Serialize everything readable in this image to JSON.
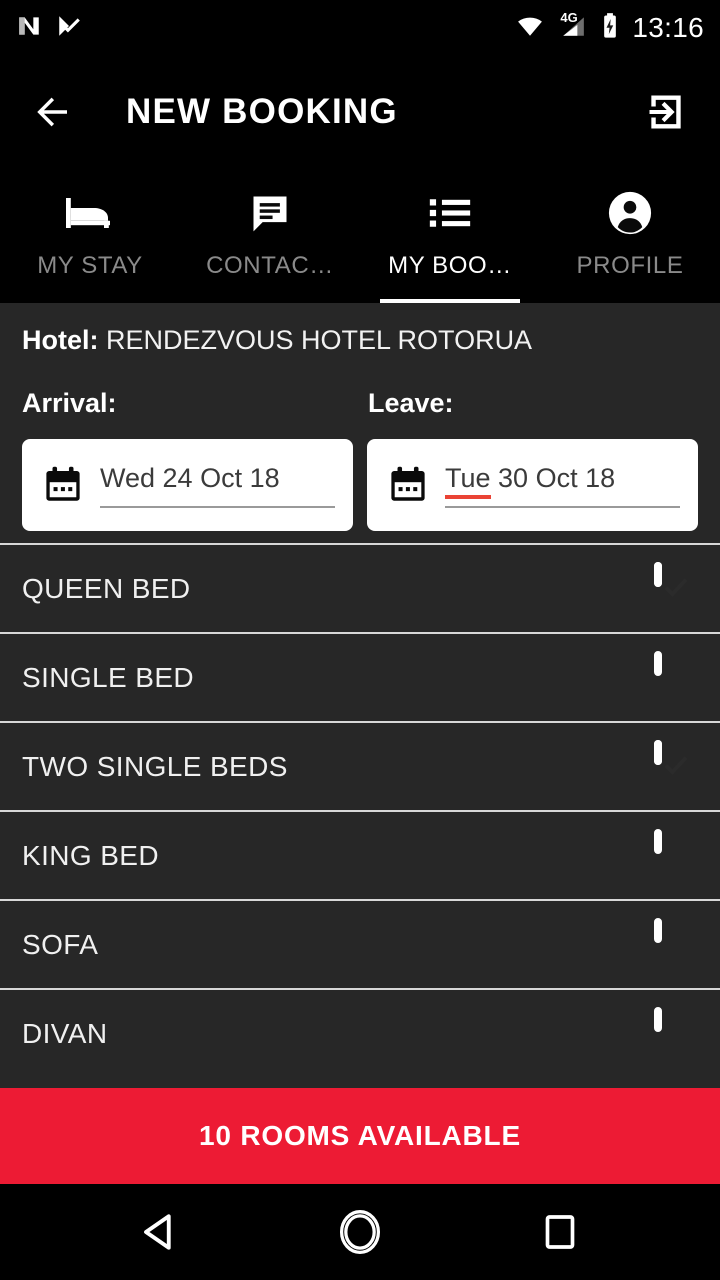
{
  "status_bar": {
    "time": "13:16",
    "notification_icons": [
      "android-n-icon",
      "check-triangle-icon"
    ],
    "system_icons": [
      "wifi-icon",
      "signal-4g-icon",
      "battery-charging-icon"
    ],
    "network_label": "4G"
  },
  "app_bar": {
    "title": "NEW BOOKING",
    "back_icon": "arrow-back-icon",
    "action_icon": "exit-to-app-icon"
  },
  "tabs": [
    {
      "label": "MY STAY",
      "icon": "bed-icon",
      "active": false
    },
    {
      "label": "CONTAC…",
      "icon": "chat-icon",
      "active": false
    },
    {
      "label": "MY BOO…",
      "icon": "list-icon",
      "active": true
    },
    {
      "label": "PROFILE",
      "icon": "person-icon",
      "active": false
    }
  ],
  "details": {
    "hotel_label": "Hotel:",
    "hotel_name": "RENDEZVOUS HOTEL ROTORUA",
    "arrival_label": "Arrival:",
    "leave_label": "Leave:",
    "arrival_value": "Wed 24 Oct 18",
    "leave_value_misspelled": "Tue",
    "leave_value_rest": " 30 Oct 18",
    "calendar_icon": "calendar-icon"
  },
  "rooms": [
    {
      "name": "QUEEN BED",
      "checked": true
    },
    {
      "name": "SINGLE BED",
      "checked": false
    },
    {
      "name": "TWO SINGLE BEDS",
      "checked": true
    },
    {
      "name": "KING BED",
      "checked": false
    },
    {
      "name": "SOFA",
      "checked": false
    },
    {
      "name": "DIVAN",
      "checked": false
    }
  ],
  "cta": {
    "label": "10 ROOMS AVAILABLE",
    "color": "#ed1b34"
  },
  "nav_bar": {
    "back": "nav-back-icon",
    "home": "nav-home-icon",
    "recents": "nav-recents-icon"
  },
  "colors": {
    "background": "#000000",
    "panel": "#272727",
    "accent_red": "#ed1b34",
    "misspell_red": "#ea4335",
    "divider": "#d8d8d8",
    "inactive_tab": "#8a8a8a"
  }
}
